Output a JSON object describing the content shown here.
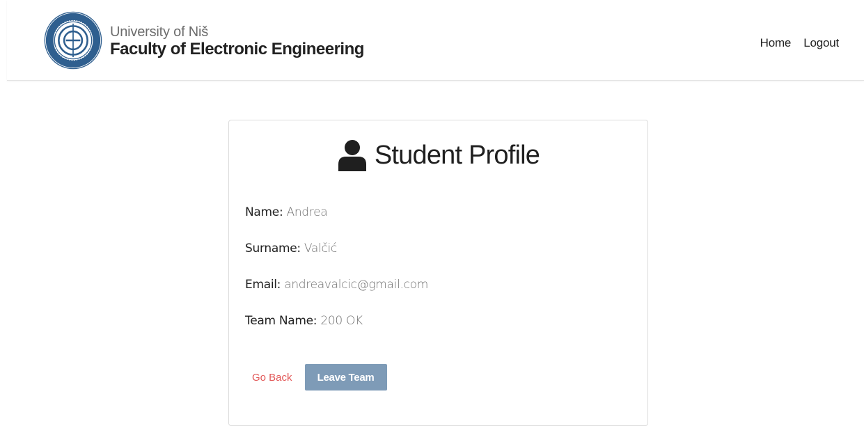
{
  "header": {
    "brand_line1": "University of Niš",
    "brand_line2": "Faculty of Electronic Engineering",
    "nav": [
      {
        "label": "Home"
      },
      {
        "label": "Logout"
      }
    ]
  },
  "profile": {
    "title": "Student Profile",
    "icon": "user-icon",
    "fields": [
      {
        "label": "Name:",
        "value": "Andrea"
      },
      {
        "label": "Surname:",
        "value": "Valčić"
      },
      {
        "label": "Email:",
        "value": "andreavalcic@gmail.com"
      },
      {
        "label": "Team Name:",
        "value": "200 OK"
      }
    ],
    "go_back_label": "Go Back",
    "leave_team_label": "Leave Team"
  },
  "colors": {
    "link_red": "#e25757",
    "button_blue": "#7e9bb7",
    "logo_blue": "#2f5f8f"
  }
}
